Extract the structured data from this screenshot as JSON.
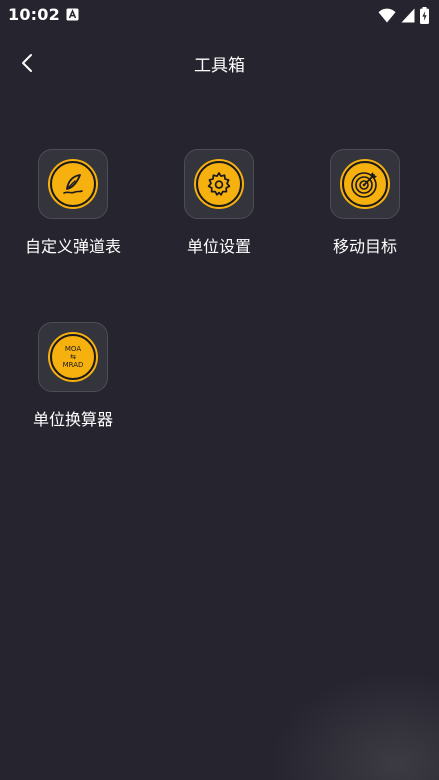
{
  "status_bar": {
    "time": "10:02",
    "notification_icon": "a-box-icon",
    "icons": [
      "wifi-icon",
      "cell-signal-icon",
      "battery-charging-icon"
    ]
  },
  "header": {
    "back_icon": "chevron-left-icon",
    "title": "工具箱"
  },
  "tools": [
    {
      "label": "自定义弹道表",
      "icon": "feather-pen-icon"
    },
    {
      "label": "单位设置",
      "icon": "gear-icon"
    },
    {
      "label": "移动目标",
      "icon": "target-icon"
    },
    {
      "label": "单位换算器",
      "icon": "moa-mrad-icon",
      "icon_text_top": "MOA",
      "icon_text_mid": "⇆",
      "icon_text_bottom": "MRAD"
    }
  ],
  "colors": {
    "background": "#26252f",
    "tile": "#34343d",
    "accent": "#f6b10f"
  }
}
